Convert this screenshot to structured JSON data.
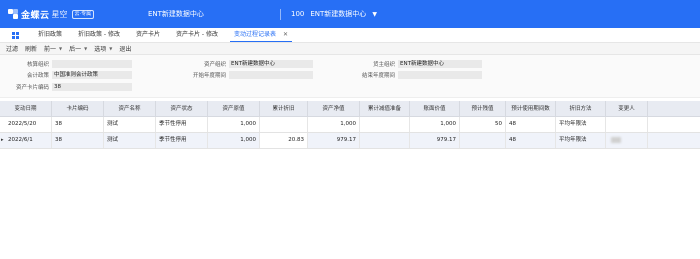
{
  "header": {
    "logo_text": "金蝶云",
    "logo_sub": "星空",
    "logo_badge": "云·专属",
    "org": "ENT新建数据中心",
    "dc_code": "100",
    "dc_name": "ENT新建数据中心"
  },
  "tabs": [
    {
      "label": "折旧政策"
    },
    {
      "label": "折旧政策 - 修改"
    },
    {
      "label": "资产卡片"
    },
    {
      "label": "资产卡片 - 修改"
    },
    {
      "label": "变动过程记录表",
      "active": true,
      "close": "✕"
    }
  ],
  "toolbar": [
    {
      "label": "过滤"
    },
    {
      "label": "刷新"
    },
    {
      "label": "前一",
      "dropdown": true
    },
    {
      "label": "后一",
      "dropdown": true
    },
    {
      "label": "选项",
      "dropdown": true
    },
    {
      "label": "退出"
    }
  ],
  "form": {
    "accounting_org_label": "核算组织",
    "accounting_org_value": "",
    "policy_label": "会计政策",
    "policy_value": "中国准则会计政策",
    "card_code_label": "资产卡片编码",
    "card_code_value": "38",
    "asset_org_label": "资产组织",
    "asset_org_value": "ENT新建数据中心",
    "start_period_label": "开始年度期间",
    "start_period_value": "",
    "owner_org_label": "货主组织",
    "owner_org_value": "ENT新建数据中心",
    "end_period_label": "结束年度期间",
    "end_period_value": ""
  },
  "table": {
    "columns": [
      "变动日期",
      "卡片编码",
      "资产名称",
      "资产状态",
      "资产原值",
      "累计折旧",
      "资产净值",
      "累计减值准备",
      "账面价值",
      "预计残值",
      "预计使用期间数",
      "折旧方法",
      "变更人"
    ],
    "rows": [
      [
        "2022/5/20",
        "38",
        "测试",
        "季节性停用",
        "1,000",
        "",
        "1,000",
        "",
        "1,000",
        "50",
        "48",
        "平均年限法",
        ""
      ],
      [
        "2022/6/1",
        "38",
        "测试",
        "季节性停用",
        "1,000",
        "20.83",
        "979.17",
        "",
        "979.17",
        "",
        "48",
        "平均年限法",
        ""
      ]
    ]
  }
}
